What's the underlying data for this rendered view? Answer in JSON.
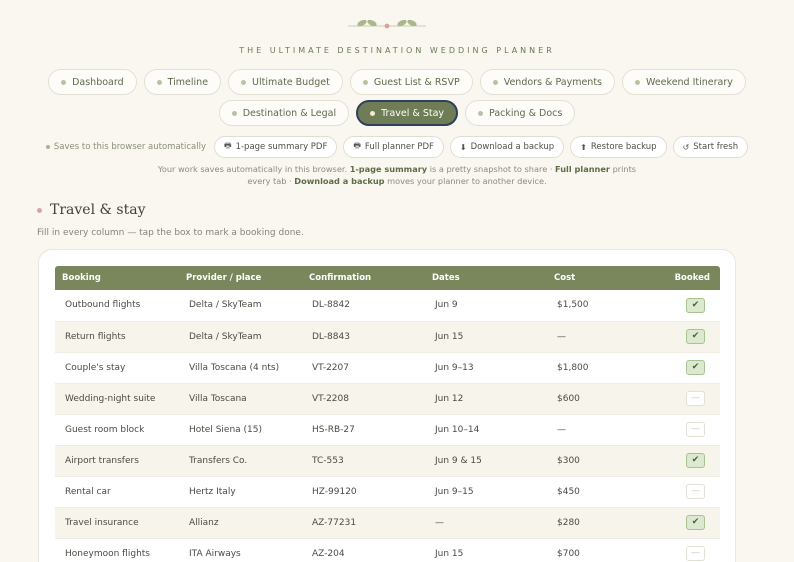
{
  "header": {
    "brand": "THE ULTIMATE DESTINATION WEDDING PLANNER"
  },
  "nav": {
    "row1": [
      {
        "label": "Dashboard"
      },
      {
        "label": "Timeline"
      },
      {
        "label": "Ultimate Budget"
      },
      {
        "label": "Guest List & RSVP"
      },
      {
        "label": "Vendors & Payments"
      },
      {
        "label": "Weekend Itinerary"
      }
    ],
    "row2": [
      {
        "label": "Destination & Legal"
      },
      {
        "label": "Travel & Stay",
        "active": true
      },
      {
        "label": "Packing & Docs"
      }
    ]
  },
  "toolbar": {
    "saves_text": "Saves to this browser automatically",
    "summary_pdf": "1-page summary PDF",
    "full_pdf": "Full planner PDF",
    "download": "Download a backup",
    "restore": "Restore backup",
    "fresh": "Start fresh"
  },
  "info": {
    "t1": "Your work saves automatically in this browser. ",
    "b1": "1-page summary",
    "t2": " is a pretty snapshot to share · ",
    "b2": "Full planner",
    "t3": " prints",
    "t4": "every tab · ",
    "b3": "Download a backup",
    "t5": " moves your planner to another device."
  },
  "section": {
    "title": "Travel & stay",
    "subtitle": "Fill in every column — tap the box to mark a booking done."
  },
  "table": {
    "headers": [
      "Booking",
      "Provider / place",
      "Confirmation",
      "Dates",
      "Cost",
      "Booked"
    ],
    "rows": [
      {
        "booking": "Outbound flights",
        "provider": "Delta / SkyTeam",
        "confirmation": "DL-8842",
        "dates": "Jun 9",
        "cost": "$1,500",
        "booked": true
      },
      {
        "booking": "Return flights",
        "provider": "Delta / SkyTeam",
        "confirmation": "DL-8843",
        "dates": "Jun 15",
        "cost": "—",
        "booked": true
      },
      {
        "booking": "Couple's stay",
        "provider": "Villa Toscana (4 nts)",
        "confirmation": "VT-2207",
        "dates": "Jun 9–13",
        "cost": "$1,800",
        "booked": true
      },
      {
        "booking": "Wedding-night suite",
        "provider": "Villa Toscana",
        "confirmation": "VT-2208",
        "dates": "Jun 12",
        "cost": "$600",
        "booked": false
      },
      {
        "booking": "Guest room block",
        "provider": "Hotel Siena (15)",
        "confirmation": "HS-RB-27",
        "dates": "Jun 10–14",
        "cost": "—",
        "booked": false
      },
      {
        "booking": "Airport transfers",
        "provider": "Transfers Co.",
        "confirmation": "TC-553",
        "dates": "Jun 9 & 15",
        "cost": "$300",
        "booked": true
      },
      {
        "booking": "Rental car",
        "provider": "Hertz Italy",
        "confirmation": "HZ-99120",
        "dates": "Jun 9–15",
        "cost": "$450",
        "booked": false
      },
      {
        "booking": "Travel insurance",
        "provider": "Allianz",
        "confirmation": "AZ-77231",
        "dates": "—",
        "cost": "$280",
        "booked": true
      },
      {
        "booking": "Honeymoon flights",
        "provider": "ITA Airways",
        "confirmation": "AZ-204",
        "dates": "Jun 15",
        "cost": "$700",
        "booked": false
      }
    ],
    "check_on": "✔",
    "check_off": "—"
  },
  "colors": {
    "accent": "#6f7d56",
    "header_bg": "#7a875d",
    "page_bg": "#faf7f1",
    "rose": "#d9a3a3"
  }
}
